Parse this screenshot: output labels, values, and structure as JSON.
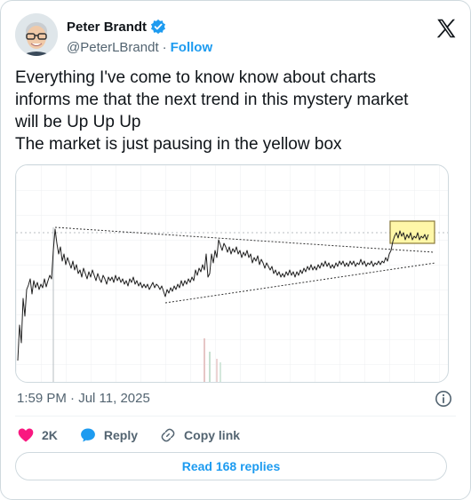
{
  "author": {
    "name": "Peter Brandt",
    "handle": "@PeterLBrandt",
    "separator": "·",
    "follow_label": "Follow"
  },
  "tweet": {
    "lines": [
      "Everything I've come to know know about charts",
      "informs me that the next trend in this mystery market",
      "will be Up Up Up",
      "The market is just pausing in the yellow box"
    ],
    "timestamp": "1:59 PM · Jul 11, 2025"
  },
  "actions": {
    "likes": "2K",
    "reply_label": "Reply",
    "copy_link_label": "Copy link"
  },
  "read_replies_label": "Read 168 replies",
  "icons": {
    "verified": "verified-badge-icon",
    "x_logo": "x-logo-icon",
    "info": "info-icon",
    "like": "heart-icon",
    "reply": "speech-bubble-icon",
    "copy_link": "link-icon"
  },
  "colors": {
    "accent": "#1d9bf0",
    "like": "#f91880",
    "highlight_box": "#fff59d"
  }
}
